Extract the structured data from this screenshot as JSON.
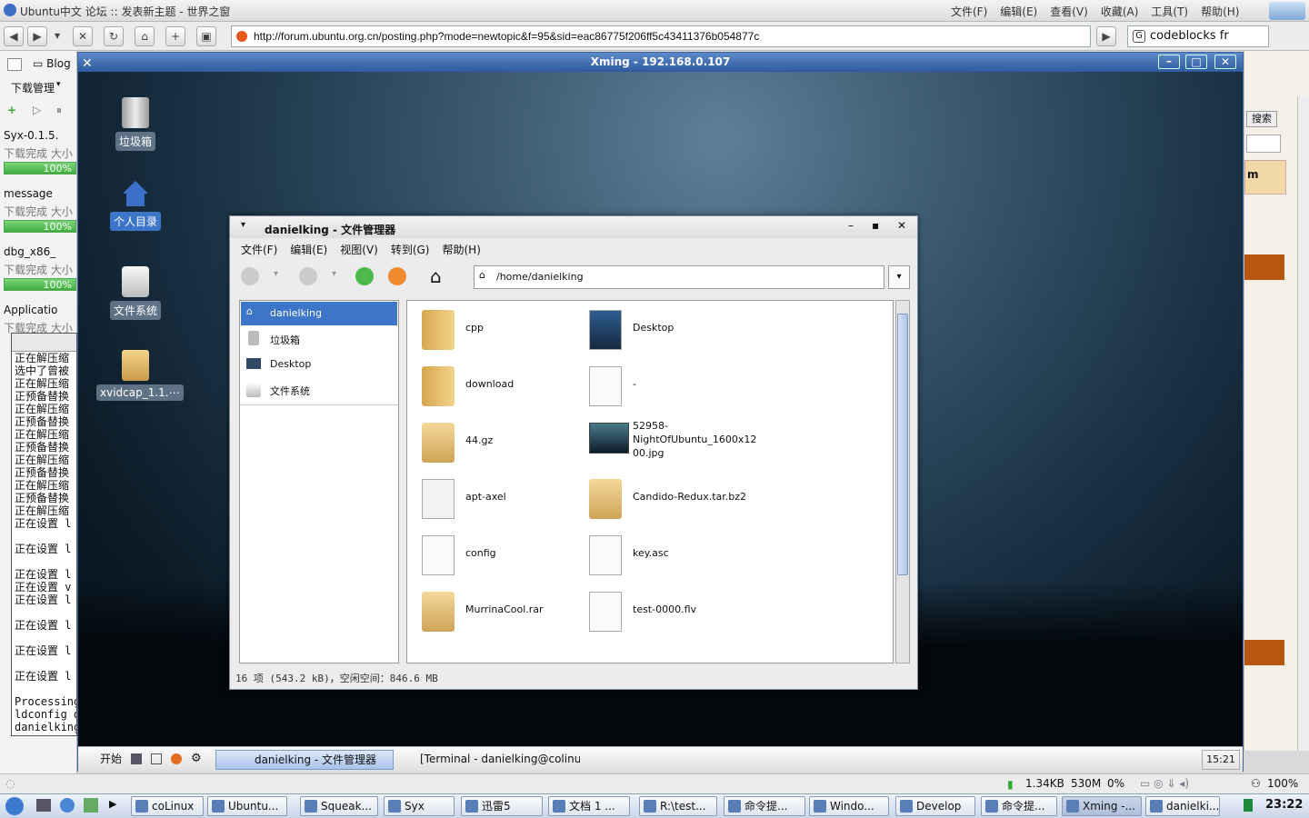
{
  "browser": {
    "title": "Ubuntu中文 论坛 :: 发表新主题 - 世界之窗",
    "menu": [
      "文件(F)",
      "编辑(E)",
      "查看(V)",
      "收藏(A)",
      "工具(T)",
      "帮助(H)"
    ],
    "url": "http://forum.ubuntu.org.cn/posting.php?mode=newtopic&f=95&sid=eac86775f206ff5c43411376b054877c",
    "search_value": "codeblocks fr",
    "sidebar_tabs": [
      "Blog"
    ],
    "download_manager_label": "下载管理"
  },
  "downloads": [
    {
      "name": "Syx-0.1.5.",
      "status": "下载完成  大小",
      "progress": "100%"
    },
    {
      "name": "message",
      "status": "下载完成  大小",
      "progress": "100%"
    },
    {
      "name": "dbg_x86_",
      "status": "下载完成  大小",
      "progress": "100%"
    },
    {
      "name": "Applicatio",
      "status": "下载完成  大小"
    }
  ],
  "terminal_lines": [
    "正在解压缩",
    "选中了曾被",
    "正在解压缩",
    "正预备替换",
    "正在解压缩",
    "正预备替换",
    "正在解压缩",
    "正预备替换",
    "正在解压缩",
    "正预备替换",
    "正在解压缩",
    "正预备替换",
    "正在解压缩",
    "正在设置 l",
    "",
    "正在设置 l",
    "",
    "正在设置 l",
    "正在设置 v",
    "正在设置 l",
    "",
    "正在设置 l",
    "",
    "正在设置 l",
    "",
    "正在设置 l",
    "",
    "Processing",
    "ldconfig d",
    "danielking"
  ],
  "right_strip": {
    "search_btn": "搜索",
    "item": "m"
  },
  "xming": {
    "title": "Xming - 192.168.0.107"
  },
  "desktop_icons": [
    {
      "label": "垃圾箱",
      "icon": "trash-icon"
    },
    {
      "label": "个人目录",
      "icon": "home-icon"
    },
    {
      "label": "文件系统",
      "icon": "drive-icon"
    },
    {
      "label": "xvidcap_1.1.⋯",
      "icon": "package-icon"
    }
  ],
  "file_manager": {
    "title": "danielking - 文件管理器",
    "menu": [
      "文件(F)",
      "编辑(E)",
      "视图(V)",
      "转到(G)",
      "帮助(H)"
    ],
    "location": "/home/danielking",
    "side": [
      "danielking",
      "垃圾箱",
      "Desktop",
      "文件系统"
    ],
    "files": [
      {
        "name": "cpp",
        "kind": "folder"
      },
      {
        "name": "Desktop",
        "kind": "desktop"
      },
      {
        "name": "download",
        "kind": "folder-gear"
      },
      {
        "name": "-",
        "kind": "file"
      },
      {
        "name": "44.gz",
        "kind": "archive"
      },
      {
        "name": "52958-\nNightOfUbuntu_1600x12\n00.jpg",
        "kind": "image"
      },
      {
        "name": "apt-axel",
        "kind": "exec"
      },
      {
        "name": "Candido-Redux.tar.bz2",
        "kind": "archive"
      },
      {
        "name": "config",
        "kind": "file"
      },
      {
        "name": "key.asc",
        "kind": "file"
      },
      {
        "name": "MurrinaCool.rar",
        "kind": "archive"
      },
      {
        "name": "test-0000.flv",
        "kind": "file"
      }
    ],
    "status": "16 项 (543.2 kB)，空闲空间：846.6 MB"
  },
  "x_taskbar": {
    "start": "开始",
    "tasks": [
      "danielking - 文件管理器",
      "[Terminal - danielking@colinux:⋯"
    ],
    "clock": "15:21"
  },
  "browser_status": {
    "speed": "1.34KB",
    "mem": "530M",
    "cpu": "0%",
    "zoom": "100%"
  },
  "win_taskbar": {
    "tasks": [
      "coLinux",
      "Ubuntu...",
      "Squeak...",
      "Syx",
      "迅雷5",
      "文档 1 ...",
      "R:\\test...",
      "命令提...",
      "Windo...",
      "Develop",
      "命令提...",
      "Xming -...",
      "danielki..."
    ],
    "clock": "23:22"
  },
  "colors": {
    "accent": "#3d6fb6",
    "selection": "#3d76c8"
  }
}
